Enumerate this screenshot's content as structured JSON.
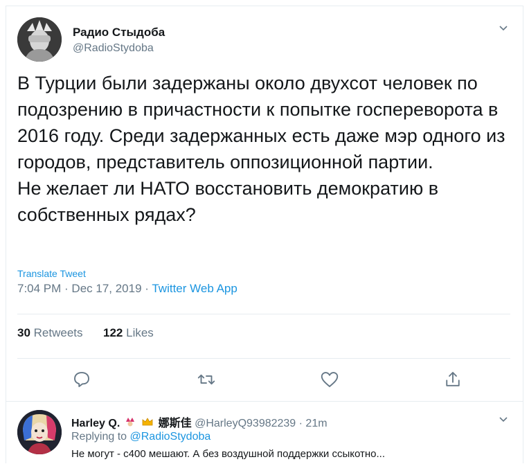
{
  "tweet": {
    "author_name": "Радио Стыдоба",
    "author_handle": "@RadioStydoba",
    "text": "В Турции были задержаны около двухсот человек по подозрению в причастности к попытке госпереворота в 2016 году. Среди задержанных есть даже мэр одного из городов, представитель оппозиционной партии.\nНе желает ли НАТО восстановить демократию в собственных рядах?",
    "translate_label": "Translate Tweet",
    "timestamp": "7:04 PM · Dec 17, 2019 ·",
    "source_app": "Twitter Web App",
    "retweets_count": "30",
    "retweets_label": "Retweets",
    "likes_count": "122",
    "likes_label": "Likes"
  },
  "actions": {
    "reply_icon": "reply-icon",
    "retweet_icon": "retweet-icon",
    "like_icon": "heart-icon",
    "share_icon": "share-icon"
  },
  "reply": {
    "author_name": "Harley Q.",
    "author_name_cn": "娜斯佳",
    "author_handle": "@HarleyQ93982239",
    "time": "· 21m",
    "replying_label": "Replying to",
    "replying_to": "@RadioStydoba",
    "text": "Не могут - с400 мешают. А без воздушной поддержки ссыкотно..."
  },
  "colors": {
    "accent": "#1b95e0",
    "secondary_text": "#657786",
    "divider": "#e6ecf0"
  }
}
